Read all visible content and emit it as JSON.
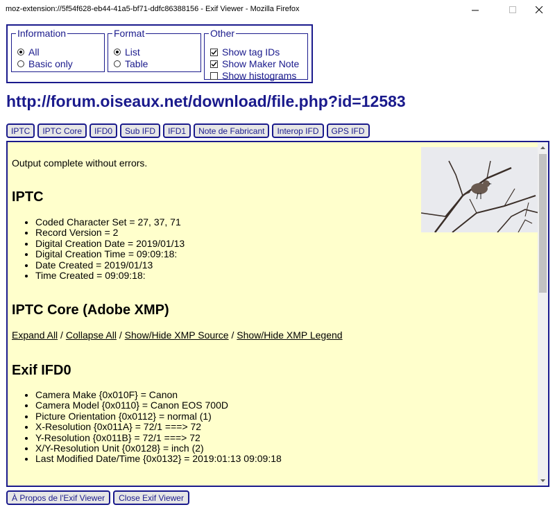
{
  "window": {
    "title": "moz-extension://5f54f628-eb44-41a5-bf71-ddfc86388156 - Exif Viewer - Mozilla Firefox"
  },
  "options": {
    "information": {
      "legend": "Information",
      "items": [
        {
          "label": "All",
          "selected": true
        },
        {
          "label": "Basic only",
          "selected": false
        }
      ]
    },
    "format": {
      "legend": "Format",
      "items": [
        {
          "label": "List",
          "selected": true
        },
        {
          "label": "Table",
          "selected": false
        }
      ]
    },
    "other": {
      "legend": "Other",
      "items": [
        {
          "label": "Show tag IDs",
          "checked": true
        },
        {
          "label": "Show Maker Note",
          "checked": true
        },
        {
          "label": "Show histograms",
          "checked": false
        }
      ]
    }
  },
  "url": "http://forum.oiseaux.net/download/file.php?id=12583",
  "tabs": [
    "IPTC",
    "IPTC Core",
    "IFD0",
    "Sub IFD",
    "IFD1",
    "Note de Fabricant",
    "Interop IFD",
    "GPS IFD"
  ],
  "content": {
    "status": "Output complete without errors.",
    "iptc": {
      "heading": "IPTC",
      "items": [
        "Coded Character Set = 27, 37, 71",
        "Record Version = 2",
        "Digital Creation Date = 2019/01/13",
        "Digital Creation Time = 09:09:18:",
        "Date Created = 2019/01/13",
        "Time Created = 09:09:18:"
      ]
    },
    "iptc_core": {
      "heading": "IPTC Core (Adobe XMP)",
      "links": [
        "Expand All",
        "Collapse All",
        "Show/Hide XMP Source",
        "Show/Hide XMP Legend"
      ],
      "sep": " / "
    },
    "ifd0": {
      "heading": "Exif IFD0",
      "items": [
        "Camera Make {0x010F} = Canon",
        "Camera Model {0x0110} = Canon EOS 700D",
        "Picture Orientation {0x0112} = normal (1)",
        "X-Resolution {0x011A} = 72/1 ===> 72",
        "Y-Resolution {0x011B} = 72/1 ===> 72",
        "X/Y-Resolution Unit {0x0128} = inch (2)",
        "Last Modified Date/Time {0x0132} = 2019:01:13 09:09:18"
      ]
    }
  },
  "buttons": {
    "about": "À Propos de l'Exif Viewer",
    "close": "Close Exif Viewer"
  },
  "colors": {
    "accent": "#1a1a8c",
    "panel_bg": "#ffffcc",
    "button_bg": "#e6e6e6"
  }
}
